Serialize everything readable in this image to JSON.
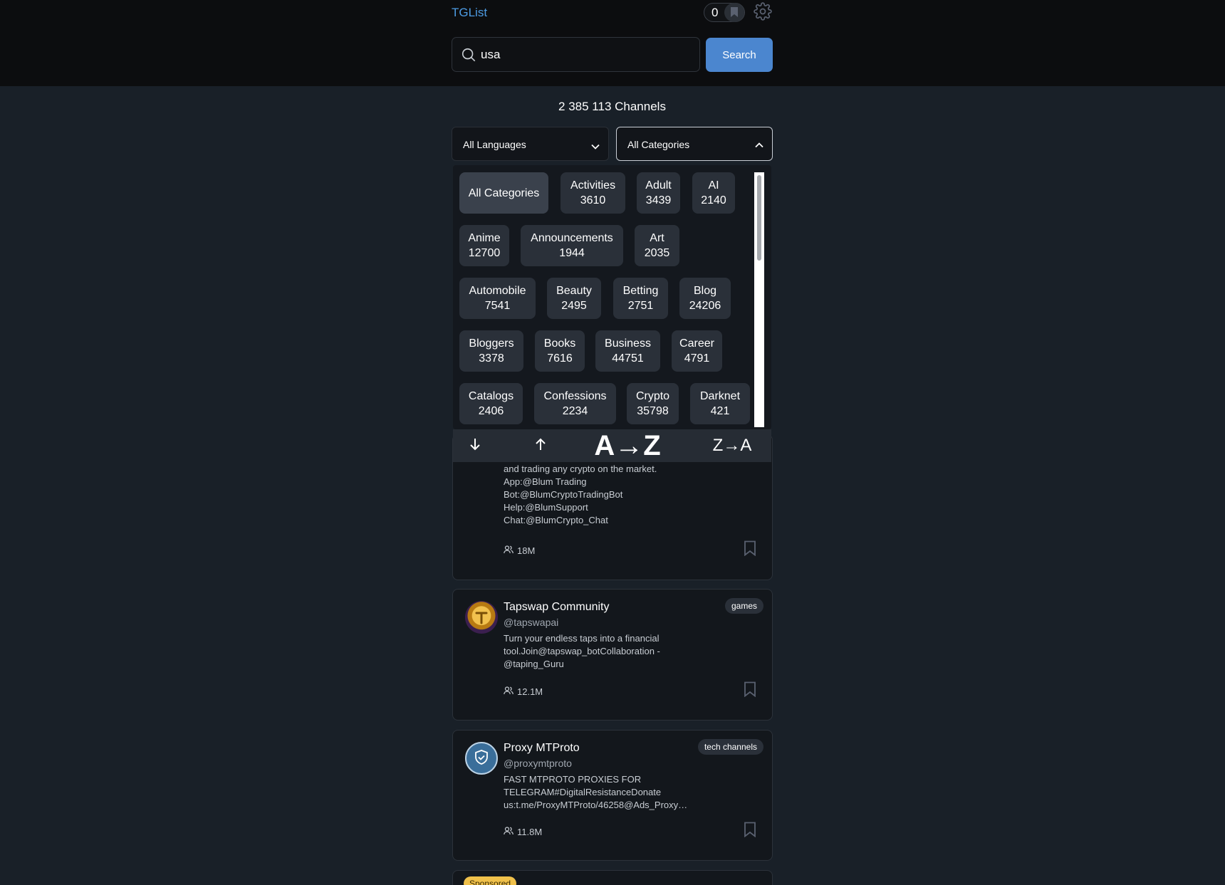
{
  "app": {
    "brand": "TGList",
    "saved_count": "0"
  },
  "search": {
    "value": "usa",
    "button_label": "Search"
  },
  "stats": {
    "channels_count": "2 385 113 Channels"
  },
  "filters": {
    "language": {
      "selected": "All Languages"
    },
    "category": {
      "selected": "All Categories",
      "expanded": true
    }
  },
  "categories": [
    {
      "name": "All Categories",
      "count": ""
    },
    {
      "name": "Activities",
      "count": "3610"
    },
    {
      "name": "Adult",
      "count": "3439"
    },
    {
      "name": "AI",
      "count": "2140"
    },
    {
      "name": "Anime",
      "count": "12700"
    },
    {
      "name": "Announcements",
      "count": "1944"
    },
    {
      "name": "Art",
      "count": "2035"
    },
    {
      "name": "Automobile",
      "count": "7541"
    },
    {
      "name": "Beauty",
      "count": "2495"
    },
    {
      "name": "Betting",
      "count": "2751"
    },
    {
      "name": "Blog",
      "count": "24206"
    },
    {
      "name": "Bloggers",
      "count": "3378"
    },
    {
      "name": "Books",
      "count": "7616"
    },
    {
      "name": "Business",
      "count": "44751"
    },
    {
      "name": "Career",
      "count": "4791"
    },
    {
      "name": "Catalogs",
      "count": "2406"
    },
    {
      "name": "Confessions",
      "count": "2234"
    },
    {
      "name": "Crypto",
      "count": "35798"
    },
    {
      "name": "Darknet",
      "count": "421"
    }
  ],
  "sort": {
    "desc_icon": "arrow-down-icon",
    "asc_icon": "arrow-up-icon",
    "az": "A→Z",
    "za": "Z→A"
  },
  "channels": [
    {
      "desc_lines": [
        "and trading any crypto on the market.",
        "App:@Blum Trading",
        "Bot:@BlumCryptoTradingBot",
        "Help:@BlumSupport",
        "Chat:@BlumCrypto_Chat"
      ],
      "members": "18M"
    },
    {
      "title": "Tapswap Community",
      "handle": "@tapswapai",
      "desc": "Turn your endless taps into a financial tool.Join@tapswap_botCollaboration - @taping_Guru",
      "tag": "games",
      "members": "12.1M"
    },
    {
      "title": "Proxy MTProto",
      "handle": "@proxymtproto",
      "desc": "FAST MTPROTO PROXIES FOR TELEGRAM#DigitalResistanceDonate us:t.me/ProxyMTProto/46258@Ads_Proxy…",
      "tag": "tech channels",
      "members": "11.8M"
    }
  ],
  "sponsored_label": "Sponsored",
  "colors": {
    "accent": "#4b86cf",
    "brand": "#4d9be3",
    "background": "#192028",
    "header": "#0c0d0f"
  }
}
